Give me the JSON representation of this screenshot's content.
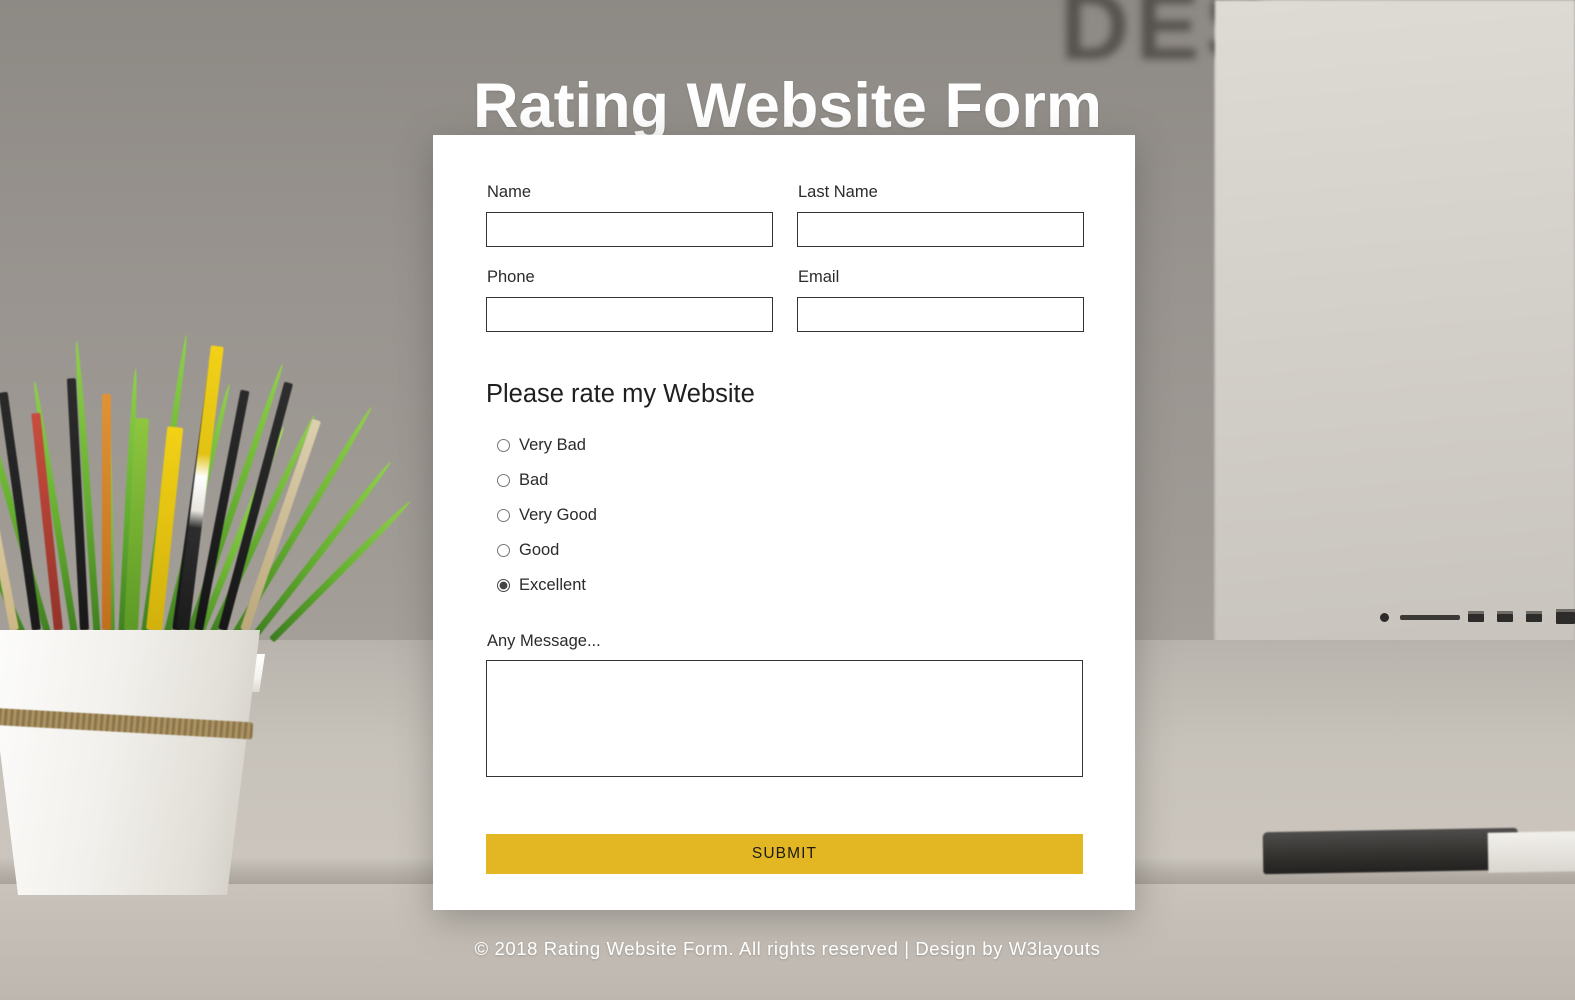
{
  "page": {
    "title": "Rating Website Form",
    "accent_color": "#e3b723",
    "background_color": "#9a9691",
    "card_background": "#ffffff",
    "background_poster_text": "DES"
  },
  "form": {
    "fields": [
      {
        "label": "Name",
        "value": "",
        "placeholder": ""
      },
      {
        "label": "Last Name",
        "value": "",
        "placeholder": ""
      },
      {
        "label": "Phone",
        "value": "",
        "placeholder": ""
      },
      {
        "label": "Email",
        "value": "",
        "placeholder": ""
      }
    ],
    "rating": {
      "heading": "Please rate my Website",
      "selected": "Excellent",
      "options": [
        {
          "label": "Very Bad",
          "checked": false
        },
        {
          "label": "Bad",
          "checked": false
        },
        {
          "label": "Very Good",
          "checked": false
        },
        {
          "label": "Good",
          "checked": false
        },
        {
          "label": "Excellent",
          "checked": true
        }
      ]
    },
    "message": {
      "label": "Any Message...",
      "value": "",
      "placeholder": ""
    },
    "submit_label": "SUBMIT"
  },
  "footer": {
    "text": "© 2018 Rating Website Form. All rights reserved | Design by W3layouts"
  }
}
